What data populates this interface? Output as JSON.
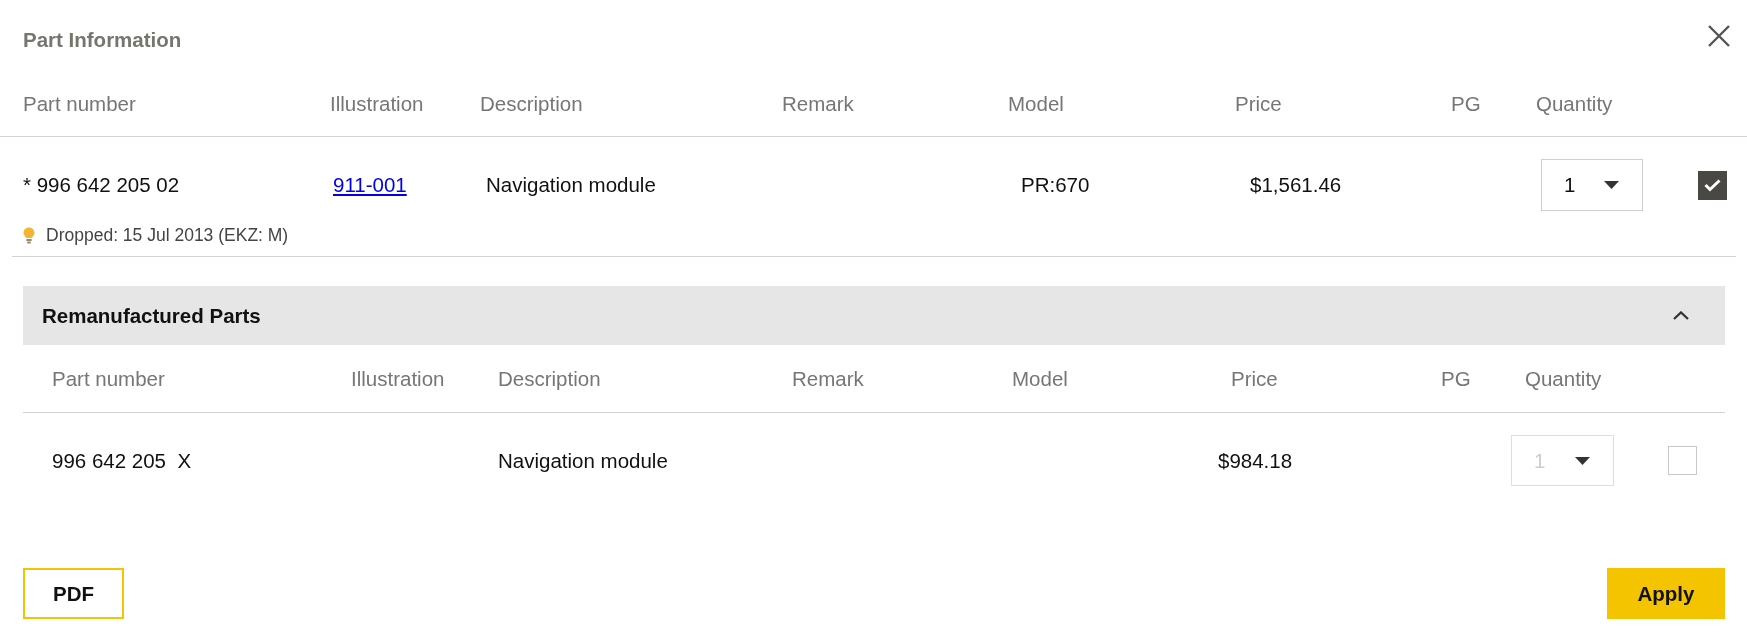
{
  "dialog": {
    "title": "Part Information"
  },
  "columns": [
    "Part number",
    "Illustration",
    "Description",
    "Remark",
    "Model",
    "Price",
    "PG",
    "Quantity"
  ],
  "parts": [
    {
      "part_number": "* 996 642 205 02",
      "illustration": "911-001",
      "description": "Navigation module",
      "model": "PR:670",
      "price": "$1,561.46",
      "quantity": {
        "value": "1",
        "disabled": false
      },
      "checked": true,
      "note": "Dropped: 15 Jul 2013 (EKZ: M)"
    }
  ],
  "remanufactured": {
    "title": "Remanufactured Parts",
    "expanded": true,
    "columns": [
      "Part number",
      "Illustration",
      "Description",
      "Remark",
      "Model",
      "Price",
      "PG",
      "Quantity"
    ],
    "parts": [
      {
        "part_number": "996 642 205  X",
        "description": "Navigation module",
        "price": "$984.18",
        "quantity": {
          "value": "1",
          "disabled": true
        },
        "checked": false
      }
    ]
  },
  "buttons": [
    {
      "label": "PDF",
      "kind": "secondary"
    },
    {
      "label": "Apply",
      "kind": "primary"
    }
  ]
}
